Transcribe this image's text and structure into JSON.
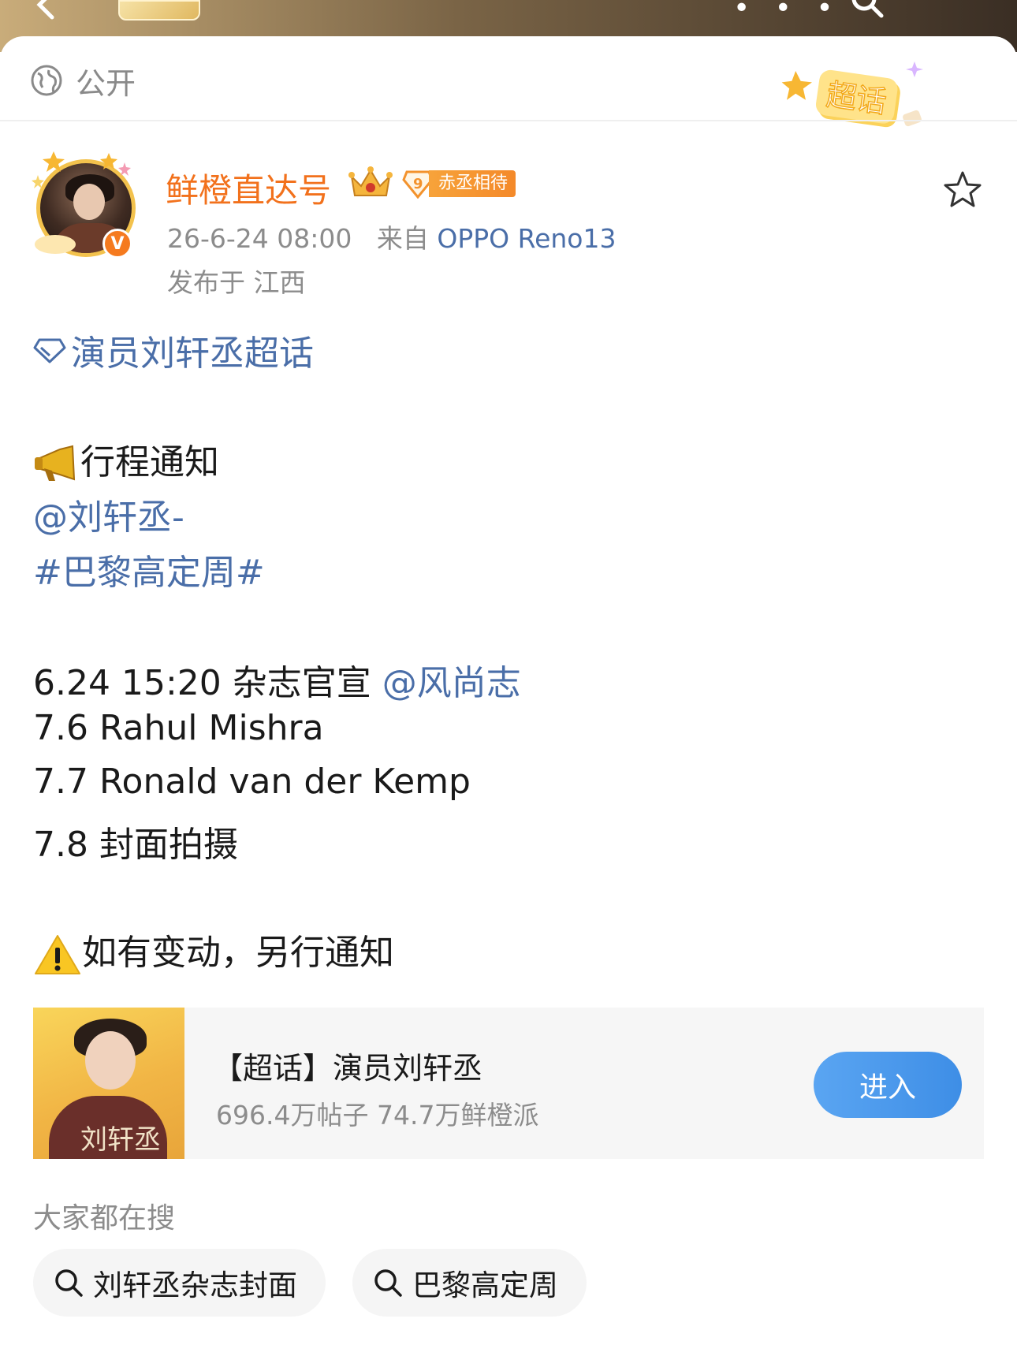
{
  "visibility": {
    "label": "公开"
  },
  "chaohua_badge": {
    "label": "超话"
  },
  "post": {
    "author": "鲜橙直达号",
    "fan_badge": {
      "level": "9",
      "label": "赤丞相待"
    },
    "time": "26-6-24 08:00",
    "source_prefix": "来自",
    "device": "OPPO Reno13",
    "location": "发布于 江西",
    "supertopic": "演员刘轩丞超话",
    "heading": "行程通知",
    "mention": "@刘轩丞-",
    "hashtag": "#巴黎高定周#",
    "schedule": [
      {
        "text": "6.24  15:20 杂志官宣",
        "mention": "@风尚志"
      },
      {
        "text": "7.6  Rahul Mishra"
      },
      {
        "text": "7.7  Ronald van der Kemp"
      },
      {
        "text": "7.8  封面拍摄"
      }
    ],
    "notice": "如有变动，另行通知"
  },
  "card": {
    "title": "【超话】演员刘轩丞",
    "stats": "696.4万帖子 74.7万鲜橙派",
    "button": "进入",
    "cover_text": "刘轩丞"
  },
  "trending": {
    "title": "大家都在搜",
    "items": [
      "刘轩丞杂志封面",
      "巴黎高定周"
    ]
  },
  "icons": [
    "back-icon",
    "search-icon",
    "more-icon",
    "globe-icon",
    "crown-icon",
    "star-icon",
    "diamond-icon",
    "megaphone-icon",
    "warning-icon",
    "verified-icon"
  ],
  "colors": {
    "accent_orange": "#f2711c",
    "link_blue": "#4a6ea8",
    "enter_blue": "#4a99ec"
  }
}
